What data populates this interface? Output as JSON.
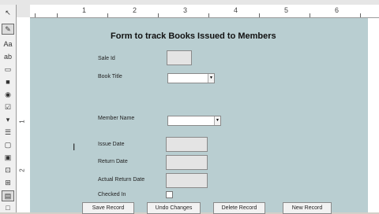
{
  "form": {
    "title": "Form to track Books Issued to Members",
    "labels": {
      "sale_id": "Sale Id",
      "book_title": "Book Title",
      "member_name": "Member Name",
      "issue_date": "Issue Date",
      "return_date": "Return Date",
      "actual_return_date": "Actual Return Date",
      "checked_in": "Checked In"
    }
  },
  "buttons": {
    "save": "Save Record",
    "undo": "Undo Changes",
    "delete": "Delete Record",
    "new": "New Record"
  },
  "ruler": {
    "numbers": [
      "1",
      "2",
      "3",
      "4",
      "5",
      "6"
    ]
  },
  "toolbox": {
    "icons": [
      "pointer",
      "wizard",
      "label",
      "textbox",
      "option-group",
      "toggle",
      "option",
      "checkbox",
      "combo",
      "list",
      "button",
      "image",
      "frame",
      "bound-frame",
      "page-break",
      "tab",
      "subform",
      "line",
      "rectangle",
      "more"
    ]
  }
}
